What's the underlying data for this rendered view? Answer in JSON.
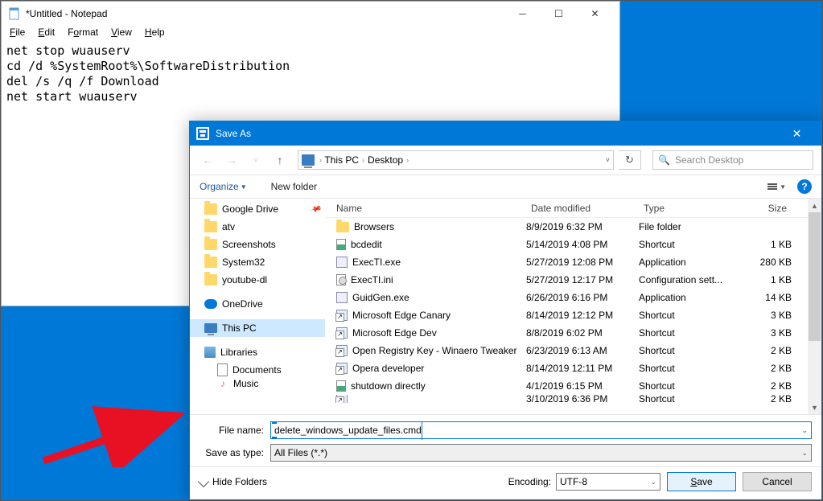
{
  "notepad": {
    "title": "*Untitled - Notepad",
    "menu": {
      "file": "File",
      "edit": "Edit",
      "format": "Format",
      "view": "View",
      "help": "Help"
    },
    "content": "net stop wuauserv\ncd /d %SystemRoot%\\SoftwareDistribution\ndel /s /q /f Download\nnet start wuauserv"
  },
  "saveas": {
    "title": "Save As",
    "breadcrumb": {
      "root": "This PC",
      "folder": "Desktop"
    },
    "search_placeholder": "Search Desktop",
    "toolbar": {
      "organize": "Organize",
      "newfolder": "New folder"
    },
    "tree": [
      {
        "label": "Google Drive",
        "icon": "folder",
        "pinned": true
      },
      {
        "label": "atv",
        "icon": "folder"
      },
      {
        "label": "Screenshots",
        "icon": "folder"
      },
      {
        "label": "System32",
        "icon": "folder"
      },
      {
        "label": "youtube-dl",
        "icon": "folder"
      },
      {
        "label": "OneDrive",
        "icon": "onedrive",
        "spaced": true
      },
      {
        "label": "This PC",
        "icon": "pc",
        "selected": true,
        "spaced": true
      },
      {
        "label": "Libraries",
        "icon": "lib",
        "spaced": true
      },
      {
        "label": "Documents",
        "icon": "doc",
        "indent": true
      },
      {
        "label": "Music",
        "icon": "music",
        "indent": true,
        "cut": true
      }
    ],
    "columns": {
      "name": "Name",
      "date": "Date modified",
      "type": "Type",
      "size": "Size"
    },
    "files": [
      {
        "name": "Browsers",
        "date": "8/9/2019 6:32 PM",
        "type": "File folder",
        "size": "",
        "icon": "folder"
      },
      {
        "name": "bcdedit",
        "date": "5/14/2019 4:08 PM",
        "type": "Shortcut",
        "size": "1 KB",
        "icon": "bat"
      },
      {
        "name": "ExecTI.exe",
        "date": "5/27/2019 12:08 PM",
        "type": "Application",
        "size": "280 KB",
        "icon": "exe"
      },
      {
        "name": "ExecTI.ini",
        "date": "5/27/2019 12:17 PM",
        "type": "Configuration sett...",
        "size": "1 KB",
        "icon": "ini"
      },
      {
        "name": "GuidGen.exe",
        "date": "6/26/2019 6:16 PM",
        "type": "Application",
        "size": "14 KB",
        "icon": "exe"
      },
      {
        "name": "Microsoft Edge Canary",
        "date": "8/14/2019 12:12 PM",
        "type": "Shortcut",
        "size": "3 KB",
        "icon": "short"
      },
      {
        "name": "Microsoft Edge Dev",
        "date": "8/8/2019 6:02 PM",
        "type": "Shortcut",
        "size": "3 KB",
        "icon": "short"
      },
      {
        "name": "Open Registry Key - Winaero Tweaker",
        "date": "6/23/2019 6:13 AM",
        "type": "Shortcut",
        "size": "2 KB",
        "icon": "short"
      },
      {
        "name": "Opera developer",
        "date": "8/14/2019 12:11 PM",
        "type": "Shortcut",
        "size": "2 KB",
        "icon": "short"
      },
      {
        "name": "shutdown directly",
        "date": "4/1/2019 6:15 PM",
        "type": "Shortcut",
        "size": "2 KB",
        "icon": "bat"
      },
      {
        "name": "",
        "date": "3/10/2019 6:36 PM",
        "type": "Shortcut",
        "size": "2 KB",
        "icon": "short",
        "cut": true
      }
    ],
    "filename_label": "File name:",
    "filename_value": "delete_windows_update_files.cmd",
    "savetype_label": "Save as type:",
    "savetype_value": "All Files  (*.*)",
    "hide_folders": "Hide Folders",
    "encoding_label": "Encoding:",
    "encoding_value": "UTF-8",
    "save_btn": "Save",
    "cancel_btn": "Cancel"
  }
}
